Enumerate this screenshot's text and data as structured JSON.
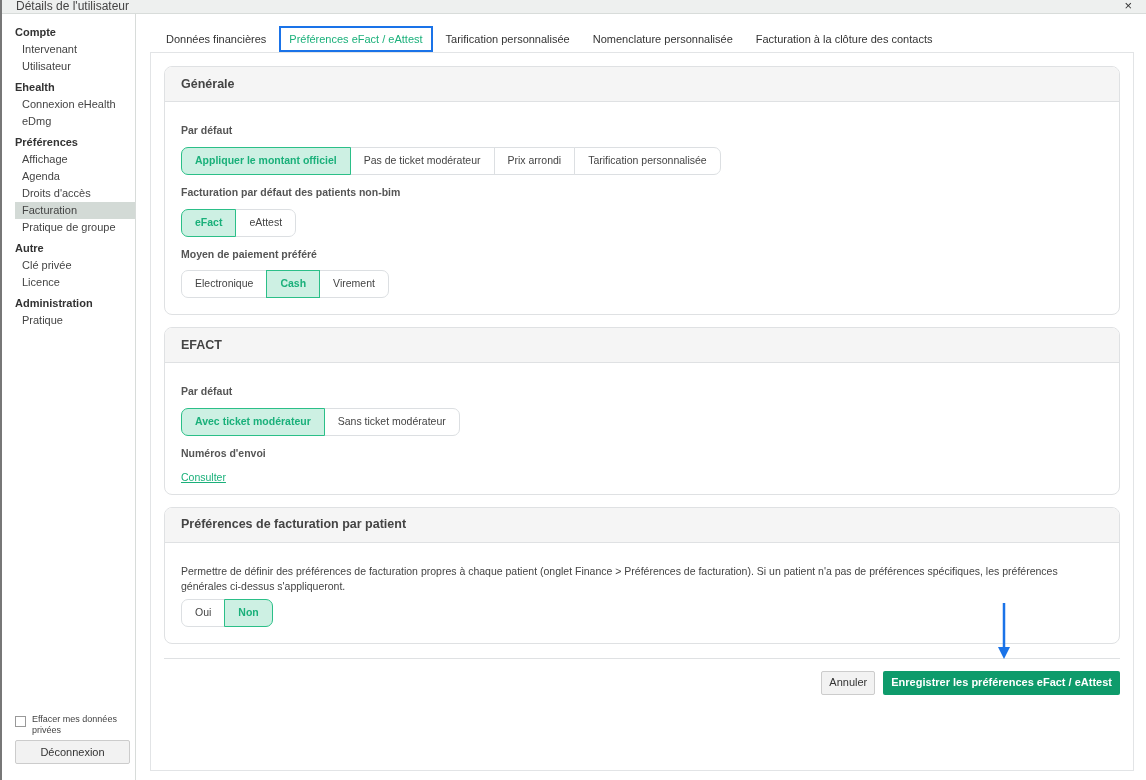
{
  "window": {
    "title": "Détails de l'utilisateur",
    "close": "×"
  },
  "sidebar": {
    "groups": [
      {
        "heading": "Compte",
        "items": [
          {
            "label": "Intervenant",
            "selected": false
          },
          {
            "label": "Utilisateur",
            "selected": false
          }
        ]
      },
      {
        "heading": "Ehealth",
        "items": [
          {
            "label": "Connexion eHealth",
            "selected": false
          },
          {
            "label": "eDmg",
            "selected": false
          }
        ]
      },
      {
        "heading": "Préférences",
        "items": [
          {
            "label": "Affichage",
            "selected": false
          },
          {
            "label": "Agenda",
            "selected": false
          },
          {
            "label": "Droits d'accès",
            "selected": false
          },
          {
            "label": "Facturation",
            "selected": true
          },
          {
            "label": "Pratique de groupe",
            "selected": false
          }
        ]
      },
      {
        "heading": "Autre",
        "items": [
          {
            "label": "Clé privée",
            "selected": false
          },
          {
            "label": "Licence",
            "selected": false
          }
        ]
      },
      {
        "heading": "Administration",
        "items": [
          {
            "label": "Pratique",
            "selected": false
          }
        ]
      }
    ],
    "clear_data": {
      "label": "Effacer mes données privées",
      "checked": false
    },
    "logout": "Déconnexion"
  },
  "tabs": [
    {
      "label": "Données financières",
      "selected": false
    },
    {
      "label": "Préférences eFact / eAttest",
      "selected": true
    },
    {
      "label": "Tarification personnalisée",
      "selected": false
    },
    {
      "label": "Nomenclature personnalisée",
      "selected": false
    },
    {
      "label": "Facturation à la clôture des contacts",
      "selected": false
    }
  ],
  "sections": [
    {
      "title": "Générale",
      "fields": [
        {
          "kind": "segmented",
          "label": "Par défaut",
          "options": [
            {
              "label": "Appliquer le montant officiel",
              "selected": true
            },
            {
              "label": "Pas de ticket modérateur",
              "selected": false
            },
            {
              "label": "Prix arrondi",
              "selected": false
            },
            {
              "label": "Tarification personnalisée",
              "selected": false
            }
          ]
        },
        {
          "kind": "segmented",
          "label": "Facturation par défaut des patients non-bim",
          "options": [
            {
              "label": "eFact",
              "selected": true
            },
            {
              "label": "eAttest",
              "selected": false
            }
          ]
        },
        {
          "kind": "segmented",
          "label": "Moyen de paiement préféré",
          "options": [
            {
              "label": "Electronique",
              "selected": false
            },
            {
              "label": "Cash",
              "selected": true
            },
            {
              "label": "Virement",
              "selected": false
            }
          ]
        }
      ]
    },
    {
      "title": "EFACT",
      "fields": [
        {
          "kind": "segmented",
          "label": "Par défaut",
          "options": [
            {
              "label": "Avec ticket modérateur",
              "selected": true
            },
            {
              "label": "Sans ticket modérateur",
              "selected": false
            }
          ]
        },
        {
          "kind": "link",
          "label": "Numéros d'envoi",
          "link": "Consulter"
        }
      ]
    },
    {
      "title": "Préférences de facturation par patient",
      "fields": [
        {
          "kind": "note",
          "text": "Permettre de définir des préférences de facturation propres à chaque patient (onglet Finance > Préférences de facturation). Si un patient n'a pas de préférences spécifiques, les préférences générales ci-dessus s'appliqueront."
        },
        {
          "kind": "segmented",
          "options": [
            {
              "label": "Oui",
              "selected": false
            },
            {
              "label": "Non",
              "selected": true
            }
          ]
        }
      ]
    }
  ],
  "actions": {
    "cancel": "Annuler",
    "save": "Enregistrer les préférences eFact / eAttest"
  }
}
